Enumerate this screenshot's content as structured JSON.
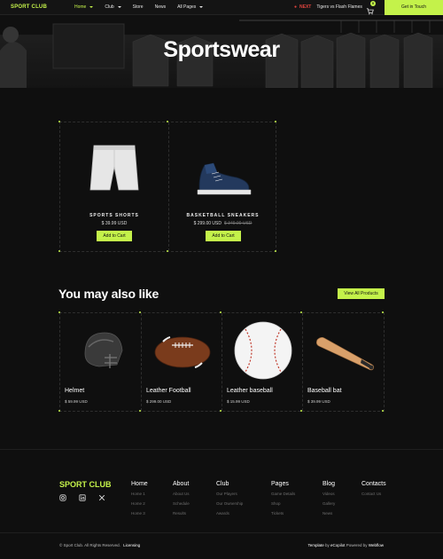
{
  "nav": {
    "logo": "SPORT CLUB",
    "items": [
      {
        "label": "Home",
        "active": true,
        "dropdown": true
      },
      {
        "label": "Club",
        "active": false,
        "dropdown": true
      },
      {
        "label": "Store",
        "active": false,
        "dropdown": false
      },
      {
        "label": "News",
        "active": false,
        "dropdown": false
      },
      {
        "label": "All Pages",
        "active": false,
        "dropdown": true
      }
    ],
    "next_label": "NEXT",
    "next_match": "Tigers vs Flash Flames",
    "cart_count": "0",
    "cta": "Get in Touch"
  },
  "hero": {
    "title": "Sportswear"
  },
  "products": [
    {
      "name": "SPORTS SHORTS",
      "price": "$ 39.99 USD",
      "old_price": "",
      "button": "Add to Cart",
      "icon": "shorts-icon"
    },
    {
      "name": "BASKETBALL SNEAKERS",
      "price": "$ 299.00 USD",
      "old_price": "$ 349.00 USD",
      "button": "Add to Cart",
      "icon": "sneaker-icon"
    }
  ],
  "related": {
    "title": "You may also like",
    "view_all": "View All Products",
    "items": [
      {
        "name": "Helmet",
        "price": "$ 59.99 USD",
        "icon": "helmet-icon"
      },
      {
        "name": "Leather Football",
        "price": "$ 299.00 USD",
        "icon": "football-icon"
      },
      {
        "name": "Leather baseball",
        "price": "$ 15.99 USD",
        "icon": "baseball-icon"
      },
      {
        "name": "Baseball bat",
        "price": "$ 39.99 USD",
        "icon": "baseball-bat-icon"
      }
    ]
  },
  "footer": {
    "logo": "SPORT CLUB",
    "socials": [
      "instagram-icon",
      "linkedin-icon",
      "x-icon"
    ],
    "columns": [
      {
        "head": "Home",
        "links": [
          "Home 1",
          "Home 2",
          "Home 3"
        ]
      },
      {
        "head": "About",
        "links": [
          "About Us",
          "Schedule",
          "Results"
        ]
      },
      {
        "head": "Club",
        "links": [
          "Our Players",
          "Our Ownership",
          "Awards"
        ]
      },
      {
        "head": "Pages",
        "links": [
          "Game Details",
          "Shop",
          "Tickets"
        ]
      },
      {
        "head": "Blog",
        "links": [
          "Videos",
          "Gallery",
          "News"
        ]
      },
      {
        "head": "Contacts",
        "links": [
          "Contact Us"
        ]
      }
    ],
    "copyright": "© Sport Club. All Rights Reserved.",
    "licensing": "Licensing",
    "credit_template": "Template",
    "credit_by": "by",
    "credit_author": "eCopilot",
    "credit_powered": "Powered by",
    "credit_platform": "Webflow"
  },
  "colors": {
    "accent": "#c4f24a",
    "background": "#0f0f0f",
    "next": "#e0443e"
  }
}
